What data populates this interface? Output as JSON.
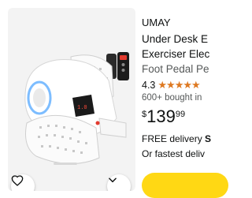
{
  "product": {
    "brand": "UMAY",
    "title_lines": [
      "Under Desk E",
      "Exerciser Elec",
      "Foot Pedal Pe"
    ],
    "rating": "4.3",
    "stars": "★★★★★",
    "bought": "600+ bought in",
    "price": {
      "currency": "$",
      "whole": "139",
      "fraction": "99"
    },
    "delivery": {
      "prefix": "FREE delivery",
      "bold": "S"
    },
    "fastest": "Or fastest deliv",
    "star_color": "#de7921",
    "cart_button_color": "#ffd814"
  },
  "image": {
    "background": "#f3f3f3",
    "remote_display": "1.0"
  },
  "icons": {
    "favorite": "heart-icon",
    "more": "chevron-down-icon"
  }
}
